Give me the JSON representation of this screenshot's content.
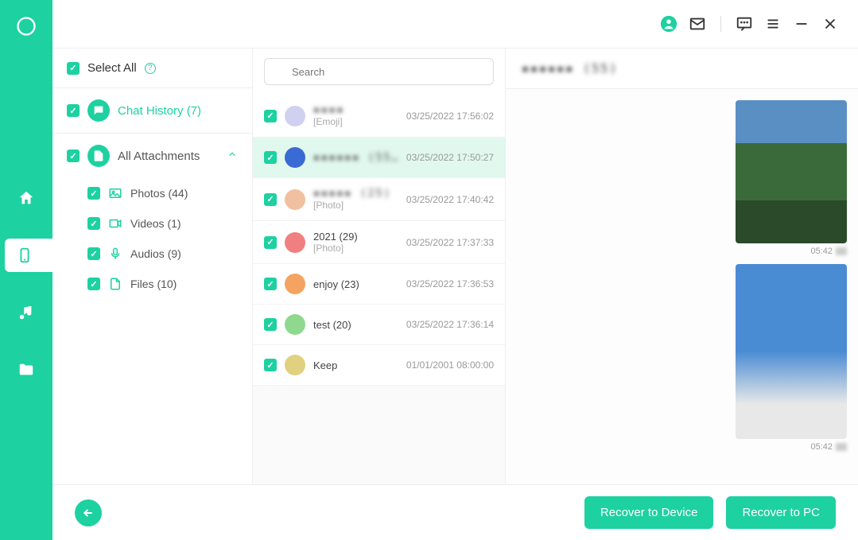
{
  "colors": {
    "accent": "#1dd1a1"
  },
  "sidebar_rail": {
    "items": [
      "home",
      "device",
      "music",
      "folder"
    ],
    "active": 1
  },
  "categories": {
    "select_all_label": "Select All",
    "chat_history": {
      "label": "Chat History (7)",
      "count": 7
    },
    "attachments": {
      "label": "All Attachments",
      "expanded": true,
      "items": [
        {
          "icon": "photo",
          "label": "Photos (44)"
        },
        {
          "icon": "video",
          "label": "Videos (1)"
        },
        {
          "icon": "audio",
          "label": "Audios (9)"
        },
        {
          "icon": "file",
          "label": "Files (10)"
        }
      ]
    }
  },
  "search": {
    "placeholder": "Search"
  },
  "chat_list": [
    {
      "title": "▪▪▪▪",
      "blurred": true,
      "subtitle": "[Emoji]",
      "time": "03/25/2022 17:56:02"
    },
    {
      "title": "▪▪▪▪▪▪ (55)",
      "blurred": true,
      "subtitle": "",
      "time": "03/25/2022 17:50:27",
      "selected": true
    },
    {
      "title": "▪▪▪▪▪ (25)",
      "blurred": true,
      "subtitle": "[Photo]",
      "time": "03/25/2022 17:40:42"
    },
    {
      "title": "2021 (29)",
      "blurred": false,
      "subtitle": "[Photo]",
      "time": "03/25/2022 17:37:33"
    },
    {
      "title": "enjoy  (23)",
      "blurred": false,
      "subtitle": "",
      "time": "03/25/2022 17:36:53"
    },
    {
      "title": "test (20)",
      "blurred": false,
      "subtitle": "",
      "time": "03/25/2022 17:36:14"
    },
    {
      "title": "Keep",
      "blurred": false,
      "subtitle": "",
      "time": "01/01/2001 08:00:00"
    }
  ],
  "detail": {
    "header": "▪▪▪▪▪▪ (55)",
    "messages": [
      {
        "type": "image",
        "variant": "landscape",
        "time": "05:42"
      },
      {
        "type": "image",
        "variant": "sky",
        "time": "05:42"
      }
    ]
  },
  "actions": {
    "recover_device": "Recover to Device",
    "recover_pc": "Recover to PC"
  }
}
